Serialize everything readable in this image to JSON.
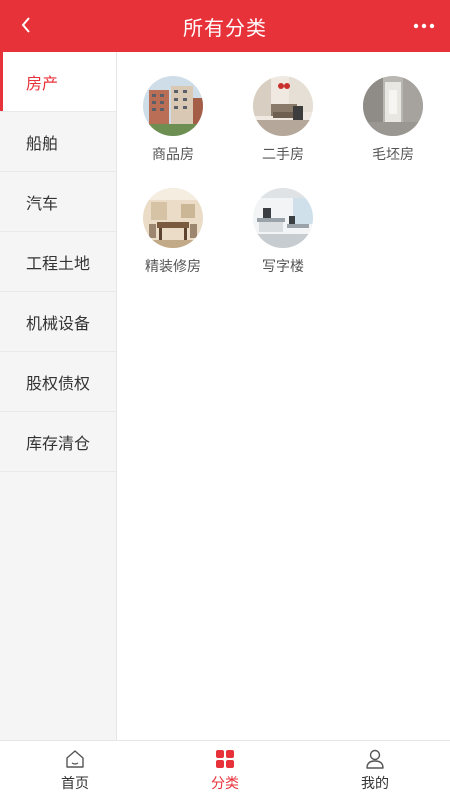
{
  "header": {
    "title": "所有分类",
    "back_icon": "chevron-left-icon",
    "more_icon": "more-dots-icon"
  },
  "sidebar": {
    "items": [
      {
        "label": "房产",
        "active": true
      },
      {
        "label": "船舶"
      },
      {
        "label": "汽车"
      },
      {
        "label": "工程土地"
      },
      {
        "label": "机械设备"
      },
      {
        "label": "股权债权"
      },
      {
        "label": "库存清仓"
      }
    ]
  },
  "categories": [
    {
      "label": "商品房"
    },
    {
      "label": "二手房"
    },
    {
      "label": "毛坯房"
    },
    {
      "label": "精装修房"
    },
    {
      "label": "写字楼"
    }
  ],
  "tabbar": {
    "tabs": [
      {
        "label": "首页",
        "icon": "home-icon"
      },
      {
        "label": "分类",
        "icon": "category-grid-icon",
        "active": true
      },
      {
        "label": "我的",
        "icon": "user-icon"
      }
    ]
  },
  "colors": {
    "accent": "#e8323a"
  }
}
